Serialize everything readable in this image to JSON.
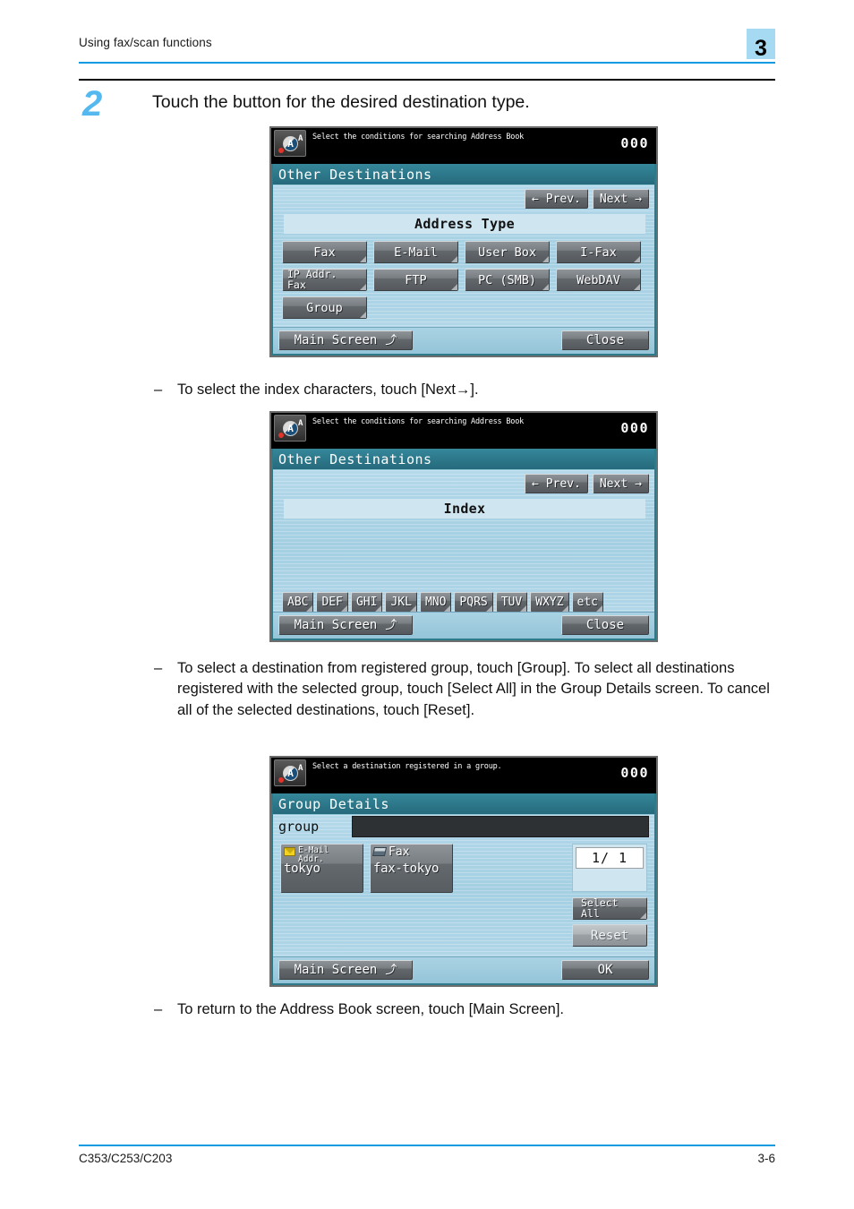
{
  "header": {
    "running_title": "Using fax/scan functions",
    "chapter_number": "3"
  },
  "step": {
    "number": "2",
    "text": "Touch the button for the desired destination type."
  },
  "bullets": {
    "b1": "To select the index characters, touch [Next→].",
    "b2": "To select a destination from registered group, touch [Group]. To select all destinations registered with the selected group, touch [Select All] in the Group Details screen. To cancel all of the selected destinations, touch [Reset].",
    "b3": "To return to the Address Book screen, touch [Main Screen].",
    "dash": "–"
  },
  "panel1": {
    "status_message": "Select the conditions for searching Address Book",
    "counter": "000",
    "title": "Other Destinations",
    "prev_label": "Prev.",
    "next_label": "Next",
    "prev_arrow": "←",
    "next_arrow": "→",
    "section_label": "Address Type",
    "buttons": [
      {
        "label": "Fax"
      },
      {
        "label": "E-Mail"
      },
      {
        "label": "User Box"
      },
      {
        "label": "I-Fax"
      },
      {
        "label_line1": "IP Addr.",
        "label_line2": "Fax"
      },
      {
        "label": "FTP"
      },
      {
        "label": "PC (SMB)"
      },
      {
        "label": "WebDAV"
      },
      {
        "label": "Group"
      }
    ],
    "main_screen_label": "Main Screen",
    "main_screen_glyph": "⤴",
    "close_label": "Close",
    "icon_letter": "A",
    "icon_sup": "A"
  },
  "panel2": {
    "status_message": "Select the conditions for searching Address Book",
    "counter": "000",
    "title": "Other Destinations",
    "prev_label": "Prev.",
    "next_label": "Next",
    "prev_arrow": "←",
    "next_arrow": "→",
    "section_label": "Index",
    "index_buttons": [
      "ABC",
      "DEF",
      "GHI",
      "JKL",
      "MNO",
      "PQRS",
      "TUV",
      "WXYZ",
      "etc"
    ],
    "main_screen_label": "Main Screen",
    "main_screen_glyph": "⤴",
    "close_label": "Close",
    "icon_letter": "A",
    "icon_sup": "A"
  },
  "panel3": {
    "status_message": "Select a destination registered in a group.",
    "counter": "000",
    "title": "Group Details",
    "group_name": "group",
    "destinations": [
      {
        "type_line1": "E-Mail",
        "type_line2": "Addr.",
        "name": "tokyo",
        "icon": "mail-icon"
      },
      {
        "type_line1": "Fax",
        "type_line2": "",
        "name": "fax-tokyo",
        "icon": "fax-icon"
      }
    ],
    "page_indicator": "1/ 1",
    "select_all_line1": "Select",
    "select_all_line2": "All",
    "reset_label": "Reset",
    "main_screen_label": "Main Screen",
    "main_screen_glyph": "⤴",
    "ok_label": "OK",
    "icon_letter": "A",
    "icon_sup": "A"
  },
  "footer": {
    "model": "C353/C253/C203",
    "page": "3-6"
  },
  "colors": {
    "accent_rule": "#0c9ae0",
    "chapter_tab_bg": "#a6d9f2",
    "step_number": "#55b9ef",
    "lcd_title_bar": "#2d7a8a",
    "lcd_body": "#a4cfe2"
  }
}
